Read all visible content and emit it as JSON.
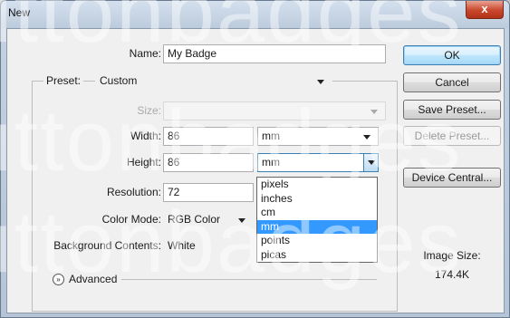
{
  "window": {
    "title": "New",
    "close_glyph": "x"
  },
  "form": {
    "name": {
      "label": "Name:",
      "value": "My Badge"
    },
    "preset": {
      "label": "Preset:",
      "value": "Custom"
    },
    "size": {
      "label": "Size:",
      "value": ""
    },
    "width": {
      "label": "Width:",
      "value": "86",
      "unit": "mm"
    },
    "height": {
      "label": "Height:",
      "value": "86",
      "unit": "mm"
    },
    "resolution": {
      "label": "Resolution:",
      "value": "72"
    },
    "color_mode": {
      "label": "Color Mode:",
      "value": "RGB Color"
    },
    "background": {
      "label": "Background Contents:",
      "value": "White"
    },
    "advanced_label": "Advanced"
  },
  "unit_dropdown": {
    "options": [
      "pixels",
      "inches",
      "cm",
      "mm",
      "points",
      "picas"
    ],
    "selected": "mm"
  },
  "buttons": {
    "ok": "OK",
    "cancel": "Cancel",
    "save_preset": "Save Preset...",
    "delete_preset": "Delete Preset...",
    "device_central": "Device Central..."
  },
  "image_size": {
    "label": "Image Size:",
    "value": "174.4K"
  },
  "icons": {
    "close": "close-icon",
    "dropdown": "chevron-down-icon",
    "advanced": "expand-chevron-icon"
  },
  "colors": {
    "selection": "#3399ff",
    "titlebar": "#c5d2e2",
    "close": "#c9462c"
  }
}
